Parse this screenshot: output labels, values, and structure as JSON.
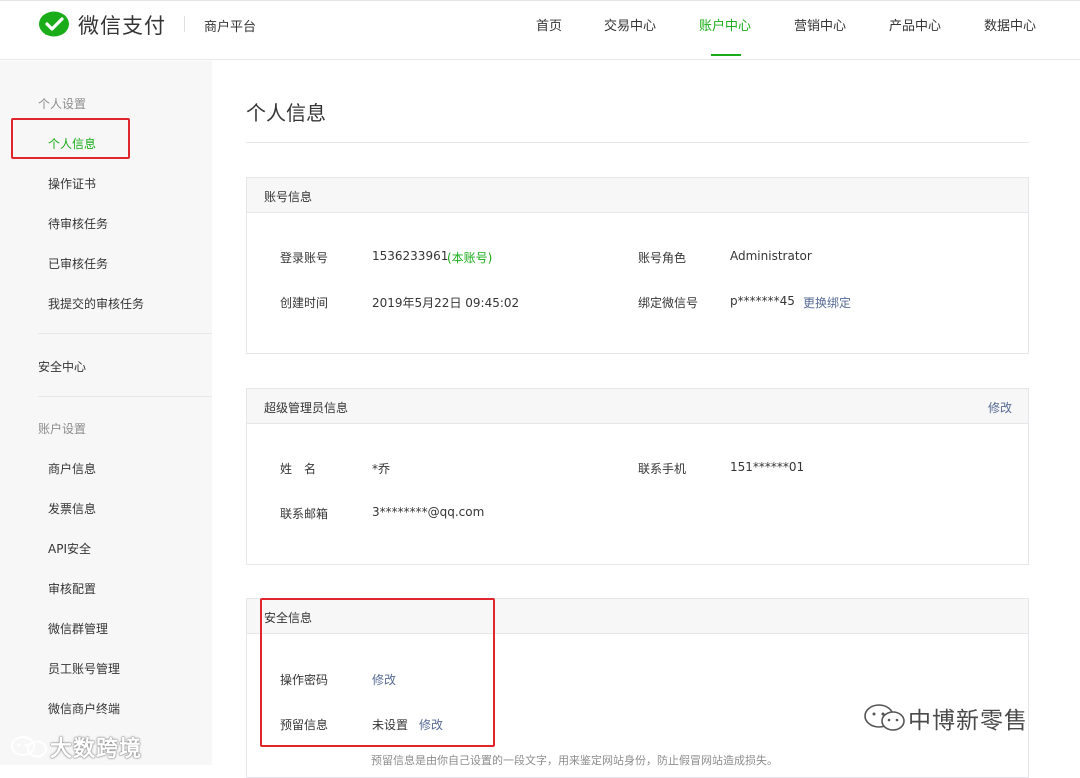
{
  "header": {
    "logo_text": "微信支付",
    "platform": "商户平台",
    "nav": [
      {
        "label": "首页"
      },
      {
        "label": "交易中心"
      },
      {
        "label": "账户中心"
      },
      {
        "label": "营销中心"
      },
      {
        "label": "产品中心"
      },
      {
        "label": "数据中心"
      }
    ],
    "active_nav": "账户中心"
  },
  "sidebar": {
    "group_personal": "个人设置",
    "personal_items": [
      {
        "label": "个人信息"
      },
      {
        "label": "操作证书"
      },
      {
        "label": "待审核任务"
      },
      {
        "label": "已审核任务"
      },
      {
        "label": "我提交的审核任务"
      }
    ],
    "security_center": "安全中心",
    "group_account": "账户设置",
    "account_items": [
      {
        "label": "商户信息"
      },
      {
        "label": "发票信息"
      },
      {
        "label": "API安全"
      },
      {
        "label": "审核配置"
      },
      {
        "label": "微信群管理"
      },
      {
        "label": "员工账号管理"
      },
      {
        "label": "微信商户终端"
      }
    ]
  },
  "main": {
    "title": "个人信息",
    "account_panel": {
      "title": "账号信息",
      "login_label": "登录账号",
      "login_value": "1536233961",
      "login_tag": "(本账号)",
      "role_label": "账号角色",
      "role_value": "Administrator",
      "created_label": "创建时间",
      "created_value": "2019年5月22日 09:45:02",
      "wechat_label": "绑定微信号",
      "wechat_value": "p*******45",
      "wechat_action": "更换绑定"
    },
    "admin_panel": {
      "title": "超级管理员信息",
      "action": "修改",
      "name_label": "姓　名",
      "name_value": "*乔",
      "phone_label": "联系手机",
      "phone_value": "151******01",
      "email_label": "联系邮箱",
      "email_value": "3********@qq.com"
    },
    "security_panel": {
      "title": "安全信息",
      "pwd_label": "操作密码",
      "pwd_action": "修改",
      "reserved_label": "预留信息",
      "reserved_value": "未设置",
      "reserved_action": "修改",
      "hint": "预留信息是由你自己设置的一段文字，用来鉴定网站身份，防止假冒网站造成损失。"
    }
  },
  "watermarks": {
    "left": "大数跨境",
    "right": "中博新零售"
  },
  "colors": {
    "brand_green": "#1aad19",
    "link_blue": "#576b95",
    "highlight_red": "#e0262d"
  }
}
